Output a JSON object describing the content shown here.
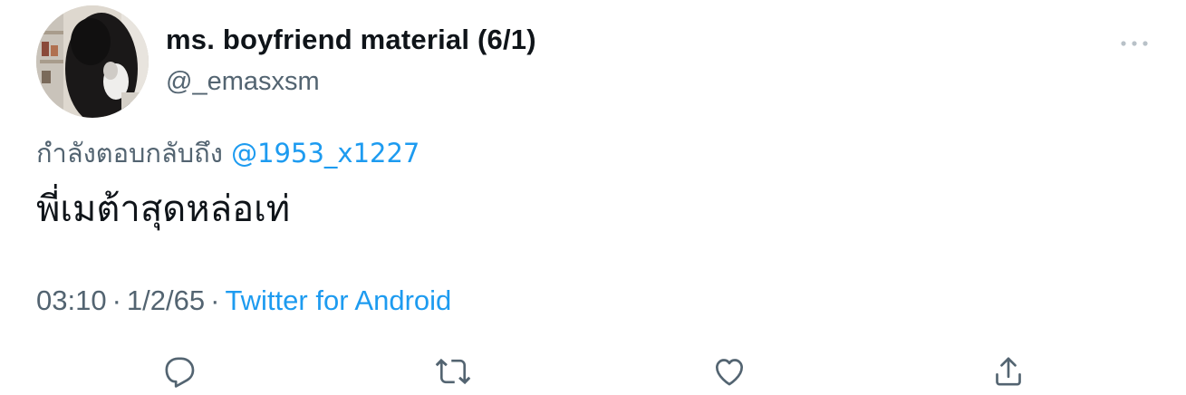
{
  "tweet": {
    "author": {
      "display_name": "ms. boyfriend material (6/1)",
      "handle": "@_emasxsm"
    },
    "reply_context": {
      "prefix": "กำลังตอบกลับถึง",
      "mention": "@1953_x1227"
    },
    "text": "พี่เมต้าสุดหล่อเท่",
    "meta": {
      "time": "03:10",
      "date": "1/2/65",
      "separator": "·",
      "source": "Twitter for Android"
    },
    "actions": {
      "reply_icon": "reply-icon",
      "retweet_icon": "retweet-icon",
      "like_icon": "heart-icon",
      "share_icon": "share-icon"
    }
  },
  "colors": {
    "text_primary": "#0f1419",
    "text_secondary": "#536471",
    "link": "#1d9bf0",
    "background": "#ffffff"
  }
}
